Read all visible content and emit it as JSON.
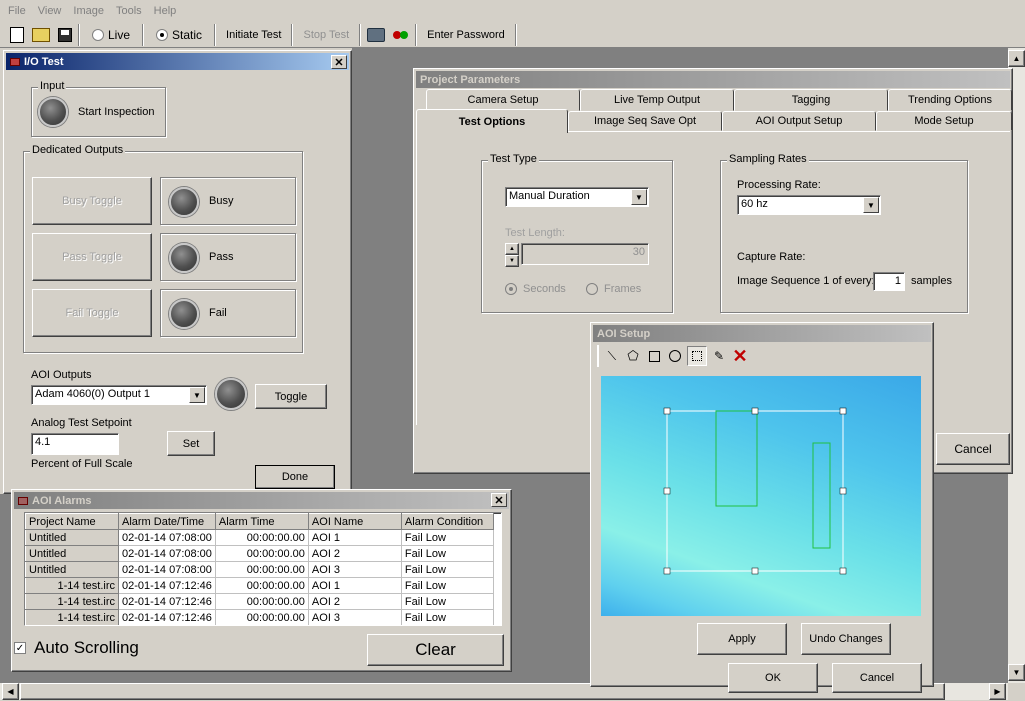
{
  "menu": [
    "File",
    "View",
    "Image",
    "Tools",
    "Help"
  ],
  "toolbar": {
    "live_label": "Live",
    "static_label": "Static",
    "initiate_label": "Initiate Test",
    "stop_label": "Stop Test",
    "password_label": "Enter Password"
  },
  "io_test": {
    "title": "I/O Test",
    "input_group": "Input",
    "start_inspection": "Start Inspection",
    "dedicated_group": "Dedicated Outputs",
    "busy_toggle": "Busy Toggle",
    "busy": "Busy",
    "pass_toggle": "Pass Toggle",
    "pass": "Pass",
    "fail_toggle": "Fail Toggle",
    "fail": "Fail",
    "aoi_outputs_label": "AOI Outputs",
    "aoi_output_value": "Adam 4060(0) Output 1",
    "toggle": "Toggle",
    "analog_label": "Analog Test Setpoint",
    "analog_value": "4.1",
    "set": "Set",
    "percent_label": "Percent of Full Scale",
    "done": "Done"
  },
  "project": {
    "title": "Project Parameters",
    "tabs_row1": [
      "Camera Setup",
      "Live Temp Output",
      "Tagging",
      "Trending Options"
    ],
    "tabs_row2": [
      "Test Options",
      "Image Seq Save Opt",
      "AOI Output Setup",
      "Mode Setup"
    ],
    "test_type_group": "Test Type",
    "test_type_value": "Manual Duration",
    "test_length_label": "Test Length:",
    "test_length_value": "30",
    "seconds": "Seconds",
    "frames": "Frames",
    "sampling_group": "Sampling Rates",
    "processing_label": "Processing Rate:",
    "processing_value": "60 hz",
    "capture_label": "Capture Rate:",
    "image_seq_label": "Image Sequence 1 of every:",
    "image_seq_value": "1",
    "samples": "samples",
    "cancel": "Cancel"
  },
  "aoi_setup": {
    "title": "AOI Setup",
    "apply": "Apply",
    "undo": "Undo Changes",
    "ok": "OK",
    "cancel": "Cancel"
  },
  "alarms": {
    "title": "AOI Alarms",
    "columns": [
      "Project Name",
      "Alarm Date/Time",
      "Alarm Time",
      "AOI Name",
      "Alarm Condition"
    ],
    "rows": [
      [
        "Untitled",
        "02-01-14 07:08:00",
        "00:00:00.00",
        "AOI 1",
        "Fail Low"
      ],
      [
        "Untitled",
        "02-01-14 07:08:00",
        "00:00:00.00",
        "AOI 2",
        "Fail Low"
      ],
      [
        "Untitled",
        "02-01-14 07:08:00",
        "00:00:00.00",
        "AOI 3",
        "Fail Low"
      ],
      [
        "1-14 test.irc",
        "02-01-14 07:12:46",
        "00:00:00.00",
        "AOI 1",
        "Fail Low"
      ],
      [
        "1-14 test.irc",
        "02-01-14 07:12:46",
        "00:00:00.00",
        "AOI 2",
        "Fail Low"
      ],
      [
        "1-14 test.irc",
        "02-01-14 07:12:46",
        "00:00:00.00",
        "AOI 3",
        "Fail Low"
      ]
    ],
    "auto_scrolling": "Auto Scrolling",
    "clear": "Clear"
  }
}
